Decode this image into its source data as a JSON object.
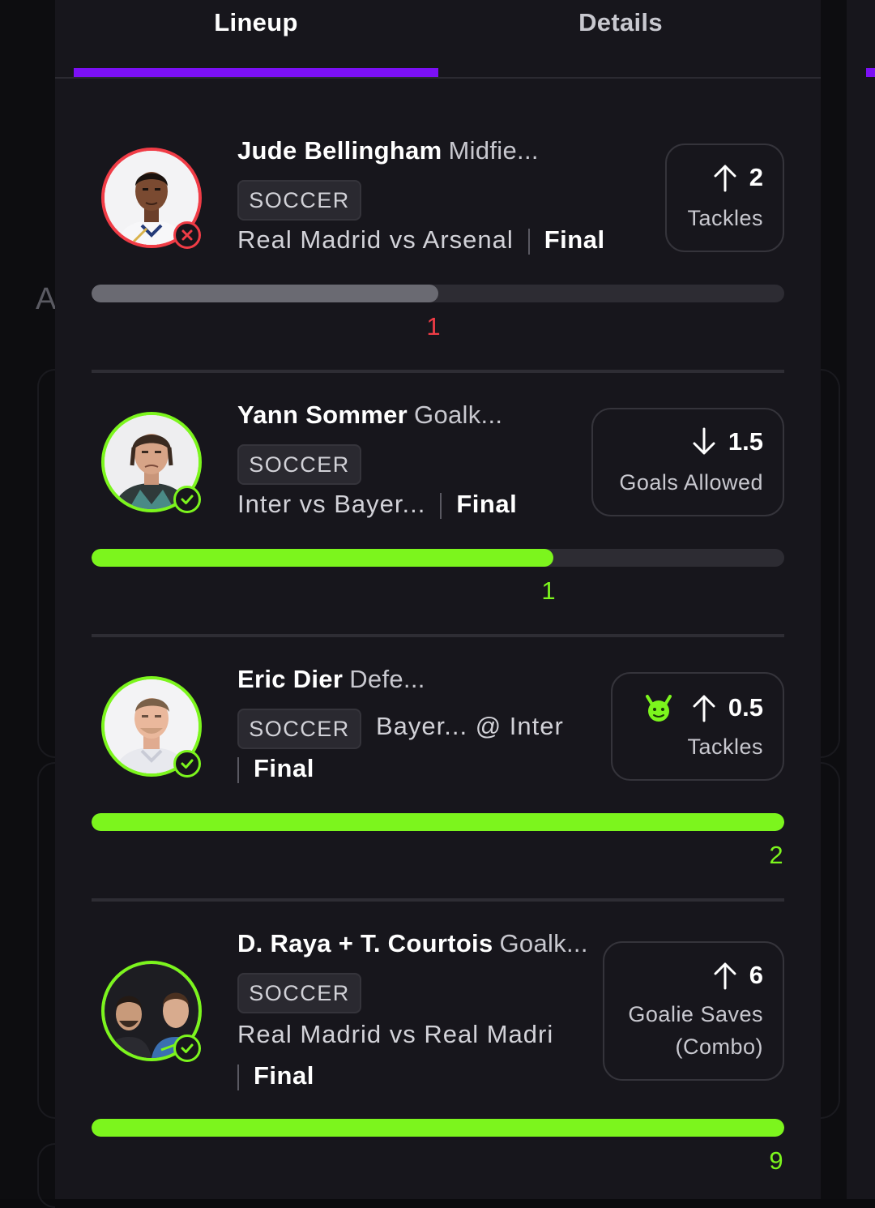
{
  "tabs": {
    "lineup_label": "Lineup",
    "details_label": "Details",
    "active": "Lineup"
  },
  "background": {
    "partial_letter": "A"
  },
  "colors": {
    "accent": "#7c10f5",
    "success": "#7cf51d",
    "error": "#f03c46",
    "panel": "#17161c"
  },
  "picks": [
    {
      "player": "Jude Bellingham",
      "position": "Midfie...",
      "sport": "SOCCER",
      "match": "Real Madrid vs Arsenal",
      "status": "Final",
      "direction": "up",
      "line": "2",
      "stat": "Tackles",
      "result": "lost",
      "actual": "1",
      "progress_fraction": 0.5,
      "icon": "arrow-up-icon"
    },
    {
      "player": "Yann Sommer",
      "position": "Goalk...",
      "sport": "SOCCER",
      "match": "Inter vs Bayer...",
      "status": "Final",
      "direction": "down",
      "line": "1.5",
      "stat": "Goals Allowed",
      "result": "won",
      "actual": "1",
      "progress_fraction": 0.667,
      "icon": "arrow-down-icon"
    },
    {
      "player": "Eric Dier",
      "position": "Defe...",
      "sport": "SOCCER",
      "match": "Bayer... @ Inter",
      "status": "Final",
      "direction": "up",
      "line": "0.5",
      "stat": "Tackles",
      "result": "won",
      "actual": "2",
      "progress_fraction": 1.0,
      "icon": "arrow-up-icon",
      "badge_icon": "demon-icon"
    },
    {
      "player": "D. Raya + T. Courtois",
      "position": "Goalk...",
      "sport": "SOCCER",
      "match": "Real Madrid vs Real Madri",
      "status": "Final",
      "direction": "up",
      "line": "6",
      "stat_line1": "Goalie Saves",
      "stat_line2": "(Combo)",
      "result": "won",
      "actual": "9",
      "progress_fraction": 1.0,
      "icon": "arrow-up-icon"
    }
  ]
}
